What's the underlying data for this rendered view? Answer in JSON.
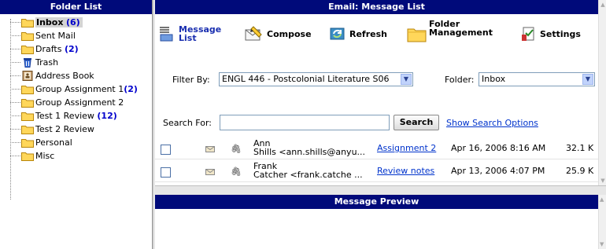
{
  "folder_list": {
    "title": "Folder List",
    "items": [
      {
        "label": "Inbox",
        "count": "(6)",
        "icon": "folder-icon"
      },
      {
        "label": "Sent Mail",
        "count": "",
        "icon": "folder-icon"
      },
      {
        "label": "Drafts",
        "count": "(2)",
        "icon": "folder-icon"
      },
      {
        "label": "Trash",
        "count": "",
        "icon": "trash-icon"
      },
      {
        "label": "Address Book",
        "count": "",
        "icon": "address-book-icon"
      },
      {
        "label": "Group Assignment 1",
        "count": "(2)",
        "icon": "folder-icon"
      },
      {
        "label": "Group Assignment 2",
        "count": "",
        "icon": "folder-icon"
      },
      {
        "label": "Test 1 Review",
        "count": "(12)",
        "icon": "folder-icon"
      },
      {
        "label": "Test 2 Review",
        "count": "",
        "icon": "folder-icon"
      },
      {
        "label": "Personal",
        "count": "",
        "icon": "folder-icon"
      },
      {
        "label": "Misc",
        "count": "",
        "icon": "folder-icon"
      }
    ]
  },
  "email": {
    "title": "Email: Message List",
    "toolbar": {
      "message_list_1": "Message",
      "message_list_2": "List",
      "compose": "Compose",
      "refresh": "Refresh",
      "folder_mgmt_1": "Folder",
      "folder_mgmt_2": "Management",
      "settings": "Settings"
    },
    "filter": {
      "label": "Filter By:",
      "value": "ENGL 446 - Postcolonial Literature S06",
      "folder_label": "Folder:",
      "folder_value": "Inbox"
    },
    "search": {
      "label": "Search For:",
      "value": "",
      "button": "Search",
      "options_link": "Show Search Options"
    },
    "messages": [
      {
        "from_name": "Ann",
        "from_addr": "Shills <ann.shills@anyu...",
        "subject": "Assignment 2",
        "date": "Apr 16, 2006 8:16 AM",
        "size": "32.1 K"
      },
      {
        "from_name": "Frank",
        "from_addr": "Catcher <frank.catche ...",
        "subject": "Review notes",
        "date": "Apr 13, 2006 4:07 PM",
        "size": "25.9 K"
      }
    ]
  },
  "preview": {
    "title": "Message Preview"
  },
  "colors": {
    "header_bg": "#000a7a",
    "link": "#0033cc",
    "count": "#0000cc",
    "folder": "#ffd75a"
  }
}
